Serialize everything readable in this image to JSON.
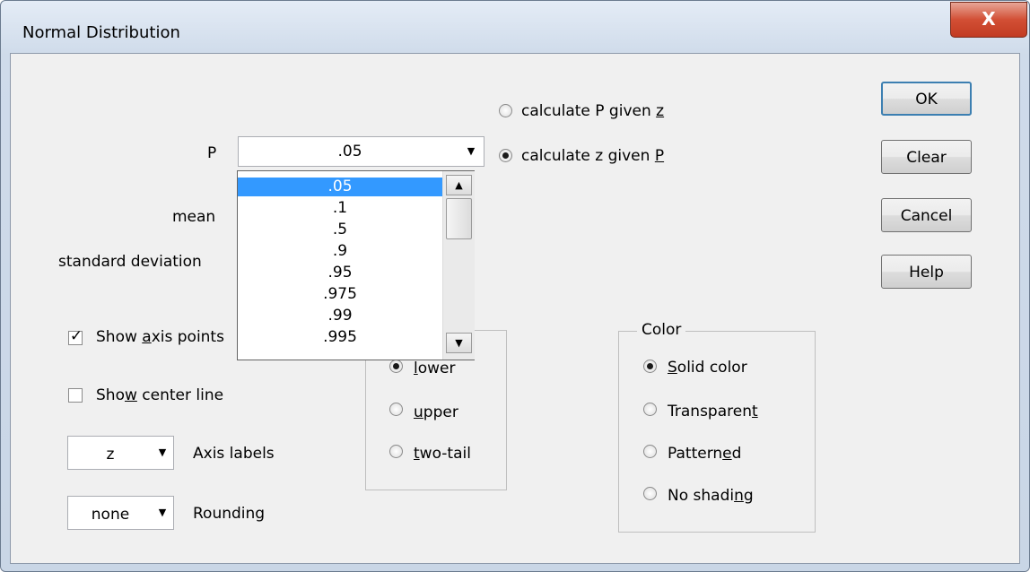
{
  "window": {
    "title": "Normal Distribution",
    "close_glyph": "X"
  },
  "buttons": {
    "ok": "OK",
    "clear": "Clear",
    "cancel": "Cancel",
    "help": "Help"
  },
  "mode": {
    "option_p_given_z": {
      "pre": "calculate P given ",
      "key": "z",
      "post": "",
      "selected": false
    },
    "option_z_given_p": {
      "pre": "calculate z given ",
      "key": "P",
      "post": "",
      "selected": true
    }
  },
  "fields": {
    "p_label": "P",
    "p_value": ".05",
    "mean_label": "mean",
    "sd_label": "standard deviation"
  },
  "p_dropdown": {
    "items": [
      ".05",
      ".1",
      ".5",
      ".9",
      ".95",
      ".975",
      ".99",
      ".995"
    ],
    "selected_index": 0
  },
  "options": {
    "show_axis_points": {
      "pre": "Show ",
      "key": "a",
      "post": "xis points",
      "checked": true
    },
    "show_center_line": {
      "pre": "Sho",
      "key": "w",
      "post": " center line",
      "checked": false
    }
  },
  "axis_labels": {
    "value": "z",
    "label": "Axis labels"
  },
  "rounding": {
    "value": "none",
    "label": "Rounding"
  },
  "tail": {
    "lower": {
      "pre": "",
      "key": "l",
      "post": "ower",
      "selected": true
    },
    "upper": {
      "pre": "",
      "key": "u",
      "post": "pper",
      "selected": false
    },
    "two_tail": {
      "pre": "",
      "key": "t",
      "post": "wo-tail",
      "selected": false
    }
  },
  "color_group": {
    "legend": "Color",
    "solid": {
      "pre": "",
      "key": "S",
      "post": "olid color",
      "selected": true
    },
    "transparent": {
      "pre": "Transparen",
      "key": "t",
      "post": "",
      "selected": false
    },
    "patterned": {
      "pre": "Pattern",
      "key": "e",
      "post": "d",
      "selected": false
    },
    "no_shading": {
      "pre": "No shadi",
      "key": "n",
      "post": "g",
      "selected": false
    }
  }
}
